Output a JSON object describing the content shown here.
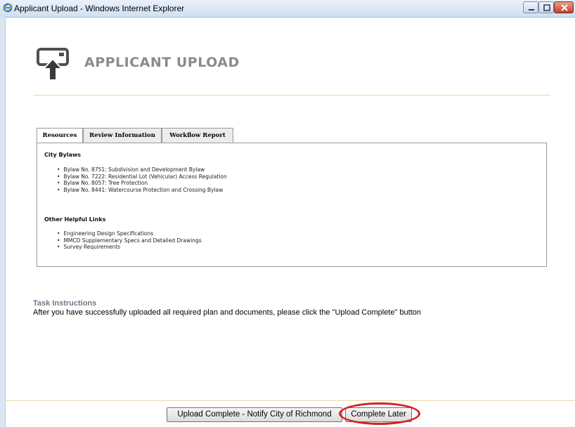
{
  "window": {
    "title": "Applicant Upload - Windows Internet Explorer",
    "icon": "ie-logo-icon",
    "controls": [
      "minimize",
      "maximize",
      "close"
    ]
  },
  "header": {
    "title": "APPLICANT UPLOAD",
    "icon": "upload-icon",
    "accent_rule_color": "#e8d9a8",
    "title_color": "#8b8b8b"
  },
  "tabs": [
    {
      "label": "Resources",
      "active": true
    },
    {
      "label": "Review Information",
      "active": false
    },
    {
      "label": "Workflow Report",
      "active": false
    }
  ],
  "resources": {
    "sections": [
      {
        "heading": "City Bylaws",
        "links": [
          "Bylaw No. 8751: Subdivision and Development Bylaw",
          "Bylaw No. 7222: Residential Lot (Vehicular) Access Regulation",
          "Bylaw No. 8057: Tree Protection",
          "Bylaw No. 8441: Watercourse Protection and Crossing Bylaw"
        ]
      },
      {
        "heading": "Other Helpful Links",
        "links": [
          "Engineering Design Specifications",
          "MMCD Supplementary Specs and Detailed Drawings",
          "Survey Requirements"
        ]
      }
    ]
  },
  "task": {
    "heading": "Task Instructions",
    "text": "After you have successfully uploaded all required plan and documents, please click the \"Upload Complete\" button"
  },
  "buttons": {
    "upload_complete": "Upload Complete - Notify City of Richmond",
    "complete_later": "Complete Later"
  },
  "annotation": {
    "highlight_color": "#d81f1f",
    "target": "complete_later"
  }
}
